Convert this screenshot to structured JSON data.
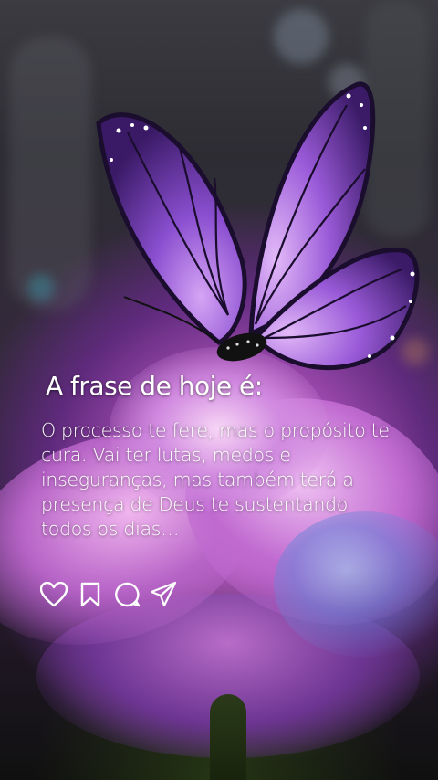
{
  "post": {
    "headline": "A frase de hoje é:",
    "quote": "O processo te fere, mas o propósito te cura. Vai ter lutas, medos e inseguranças, mas também terá a presença de Deus te sustentando todos os dias…"
  },
  "actions": [
    {
      "icon": "heart-icon"
    },
    {
      "icon": "bookmark-icon"
    },
    {
      "icon": "comment-icon"
    },
    {
      "icon": "send-icon"
    }
  ],
  "colors": {
    "text": "#ffffff",
    "butterfly_primary": "#7b3fc0",
    "butterfly_light": "#c48cf0",
    "petal": "#d98ad8"
  }
}
